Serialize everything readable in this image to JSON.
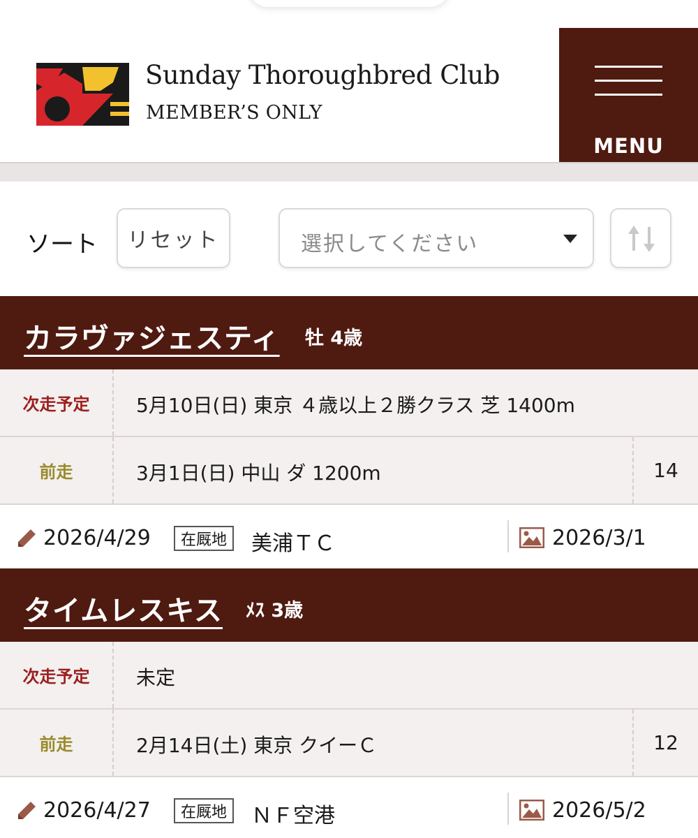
{
  "header": {
    "title": "Sunday Thoroughbred Club",
    "subtitle": "MEMBER’S ONLY",
    "menu_label": "MENU"
  },
  "sort": {
    "label": "ソート",
    "reset_label": "リセット",
    "select_placeholder": "選択してください"
  },
  "horses": [
    {
      "name": "カラヴァジェスティ",
      "meta": "牡 4歳",
      "next_label": "次走予定",
      "next_value": "5月10日(日) 東京 ４歳以上２勝クラス 芝 1400m",
      "prev_label": "前走",
      "prev_value": "3月1日(日) 中山 ダ 1200m",
      "prev_result": "14",
      "update_date": "2026/4/29",
      "location_tag": "在厩地",
      "location": "美浦ＴＣ",
      "photo_date": "2026/3/1"
    },
    {
      "name": "タイムレスキス",
      "meta": "ﾒｽ 3歳",
      "next_label": "次走予定",
      "next_value": "未定",
      "prev_label": "前走",
      "prev_value": "2月14日(土) 東京 クイーＣ",
      "prev_result": "12",
      "update_date": "2026/4/27",
      "location_tag": "在厩地",
      "location": "ＮＦ空港",
      "photo_date": "2026/5/2"
    }
  ],
  "colors": {
    "brand_brown": "#4f1a10",
    "next_label_red": "#9b1f1f",
    "prev_label_olive": "#9a8a2c",
    "icon_brown": "#9a5a4a"
  },
  "icons": [
    "pencil-icon",
    "image-icon",
    "sort-order-icon",
    "hamburger-icon",
    "chevron-down-icon"
  ]
}
